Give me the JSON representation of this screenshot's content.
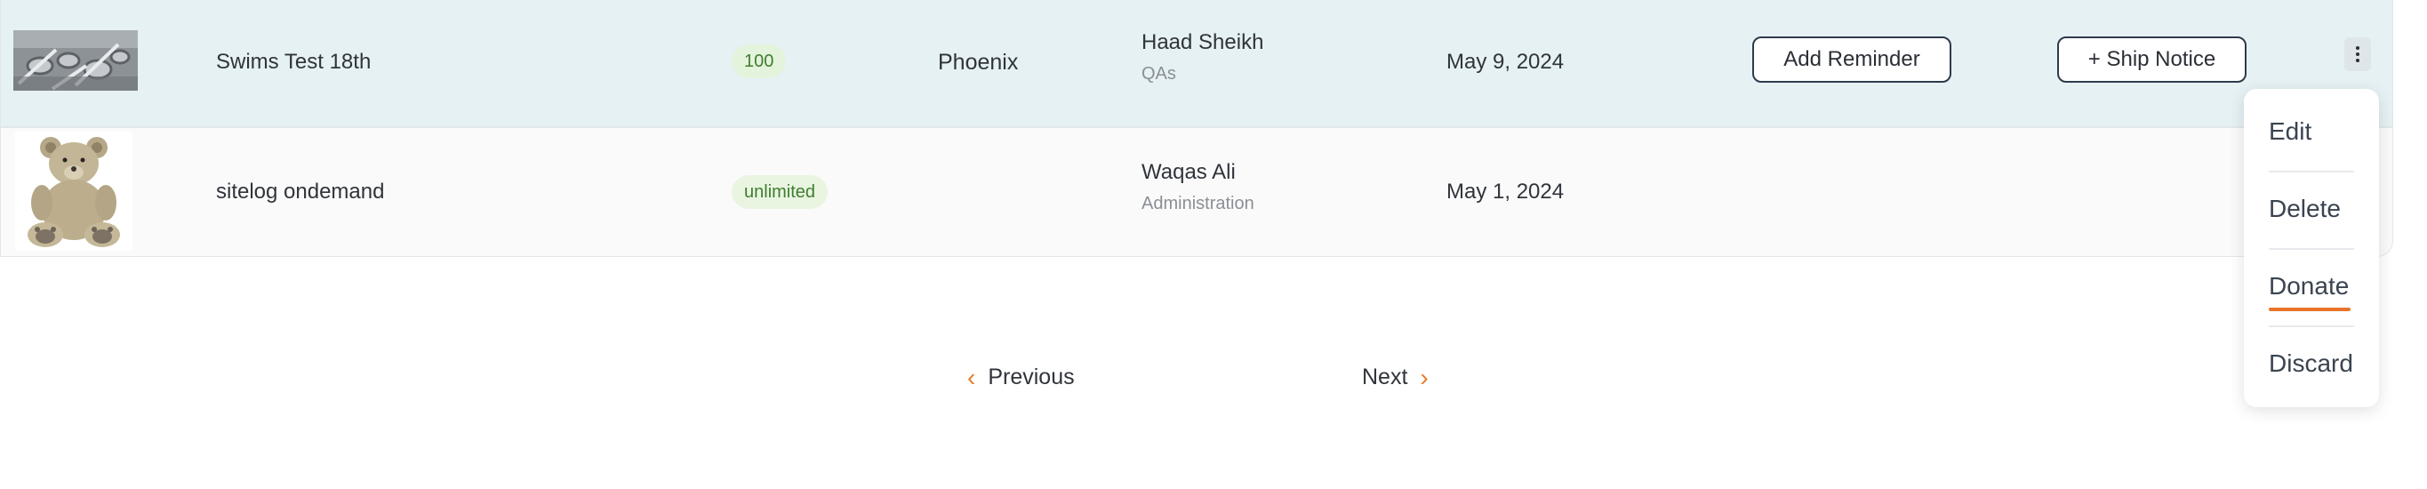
{
  "rows": [
    {
      "image": "machinery-parts-photo",
      "title": "Swims Test 18th",
      "quantity": "100",
      "location": "Phoenix",
      "person": {
        "name": "Haad Sheikh",
        "department": "QAs"
      },
      "date": "May 9, 2024",
      "actions": {
        "reminder": "Add Reminder",
        "ship": "+ Ship Notice"
      }
    },
    {
      "image": "teddy-bear-photo",
      "title": "sitelog ondemand",
      "quantity": "unlimited",
      "location": "",
      "person": {
        "name": "Waqas Ali",
        "department": "Administration"
      },
      "date": "May 1, 2024"
    }
  ],
  "pagination": {
    "previous": "Previous",
    "next": "Next"
  },
  "menu": {
    "items": [
      "Edit",
      "Delete",
      "Donate",
      "Discard"
    ],
    "active": "Donate"
  },
  "colors": {
    "accent": "#e8742a",
    "row_highlight": "#e6f1f4",
    "pill_bg": "#e4f3dc",
    "pill_text": "#3f7d2e",
    "button_border": "#2f3b4d"
  }
}
